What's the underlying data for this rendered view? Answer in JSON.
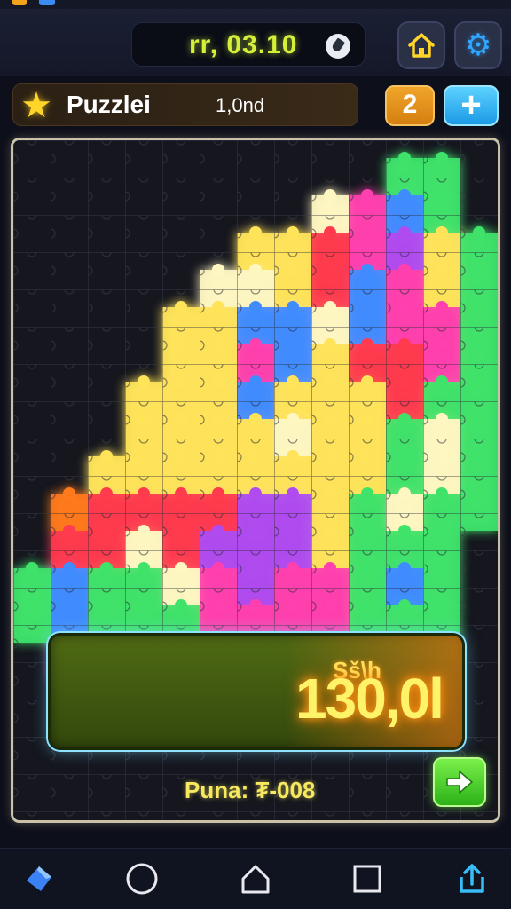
{
  "topbar": {
    "timer": "rr, 03.10",
    "icons": {
      "timer": "rocket-icon",
      "home": "home-icon",
      "settings": "gear-icon"
    }
  },
  "infobar": {
    "title": "Puzzlei",
    "level": "1,0nd",
    "star_icon": "star-icon",
    "count": "2",
    "add_label": "+"
  },
  "score": {
    "top": "Sš\\h",
    "main": "130,0l"
  },
  "footer": {
    "points_text": "Puna: ₮-008",
    "next_icon": "arrow-right-icon"
  },
  "navbar": {
    "items": [
      "app-icon",
      "circle-home-icon",
      "home-outline-icon",
      "square-recents-icon",
      "share-icon"
    ]
  },
  "colors": {
    "accent_yellow": "#d6f03a",
    "accent_blue": "#30a8ff",
    "board_border": "#c9c2a8",
    "piece_yellow": "#ffe45a",
    "piece_pink": "#ff3fae",
    "piece_green": "#3fe36a",
    "piece_blue": "#3f8cff",
    "piece_red": "#ff3a4e",
    "piece_purple": "#b04cf0",
    "piece_orange": "#ff7a1a"
  }
}
